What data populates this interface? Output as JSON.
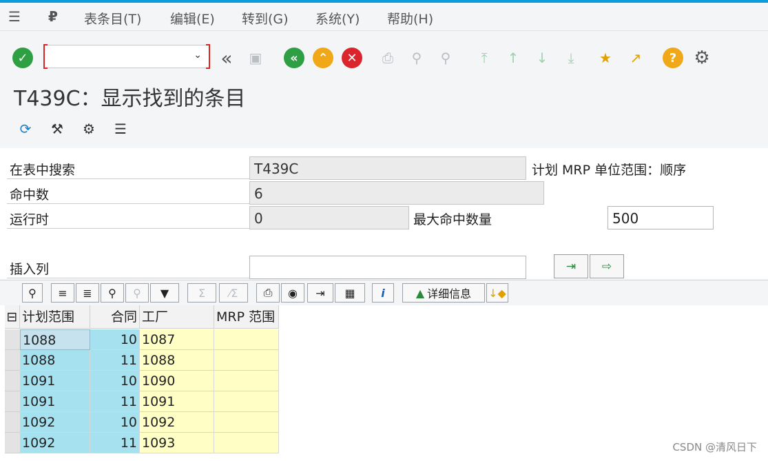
{
  "menu": {
    "items": [
      "表条目(T)",
      "编辑(E)",
      "转到(G)",
      "系统(Y)",
      "帮助(H)"
    ]
  },
  "toolbar": {
    "command_value": "",
    "icons": [
      "enter-icon",
      "back-double-icon",
      "save-icon",
      "back-icon",
      "exit-icon",
      "cancel-icon",
      "print-icon",
      "find-icon",
      "find-next-icon",
      "first-page-icon",
      "previous-page-icon",
      "next-page-icon",
      "last-page-icon",
      "create-session-icon",
      "shortcut-icon",
      "help-icon",
      "settings-icon"
    ]
  },
  "page": {
    "title": "T439C：显示找到的条目"
  },
  "form": {
    "table_label": "在表中搜索",
    "table_value": "T439C",
    "table_desc": "计划 MRP 单位范围：顺序",
    "hits_label": "命中数",
    "hits_value": "6",
    "runtime_label": "运行时",
    "runtime_value": "0",
    "maxhits_label": "最大命中数量",
    "maxhits_value": "500",
    "insert_label": "插入列",
    "insert_value": ""
  },
  "alv": {
    "details_label": "详细信息",
    "columns": [
      "计划范围",
      "合同",
      "工厂",
      "MRP 范围"
    ],
    "rows": [
      [
        "1088",
        "10",
        "1087",
        ""
      ],
      [
        "1088",
        "11",
        "1088",
        ""
      ],
      [
        "1091",
        "10",
        "1090",
        ""
      ],
      [
        "1091",
        "11",
        "1091",
        ""
      ],
      [
        "1092",
        "10",
        "1092",
        ""
      ],
      [
        "1092",
        "11",
        "1093",
        ""
      ]
    ]
  },
  "colors": {
    "key_cell": "#a6e1f0",
    "data_cell": "#ffffc5",
    "accent": "#0a9dd9"
  },
  "watermark": "CSDN @清风日下"
}
